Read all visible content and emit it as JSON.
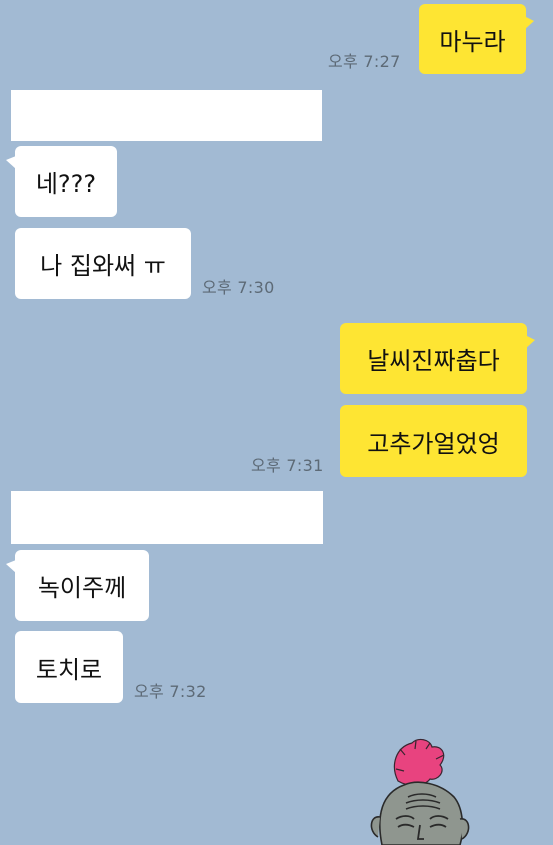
{
  "chat": {
    "messages": [
      {
        "side": "out",
        "text": "마누라",
        "time": "오후 7:27"
      },
      {
        "side": "in",
        "text": "네???"
      },
      {
        "side": "in",
        "text": "나 집와써 ㅠ",
        "time": "오후 7:30"
      },
      {
        "side": "out",
        "text": "날씨진짜춥다"
      },
      {
        "side": "out",
        "text": "고추가얼었엉",
        "time": "오후 7:31"
      },
      {
        "side": "in",
        "text": "녹이주께"
      },
      {
        "side": "in",
        "text": "토치로",
        "time": "오후 7:32"
      }
    ]
  },
  "colors": {
    "background": "#a2bad3",
    "outgoing_bubble": "#fee533",
    "incoming_bubble": "#ffffff",
    "sticker_hair": "#e8437f"
  },
  "sticker": {
    "icon": "bald-man-pink-hair-sticker"
  }
}
